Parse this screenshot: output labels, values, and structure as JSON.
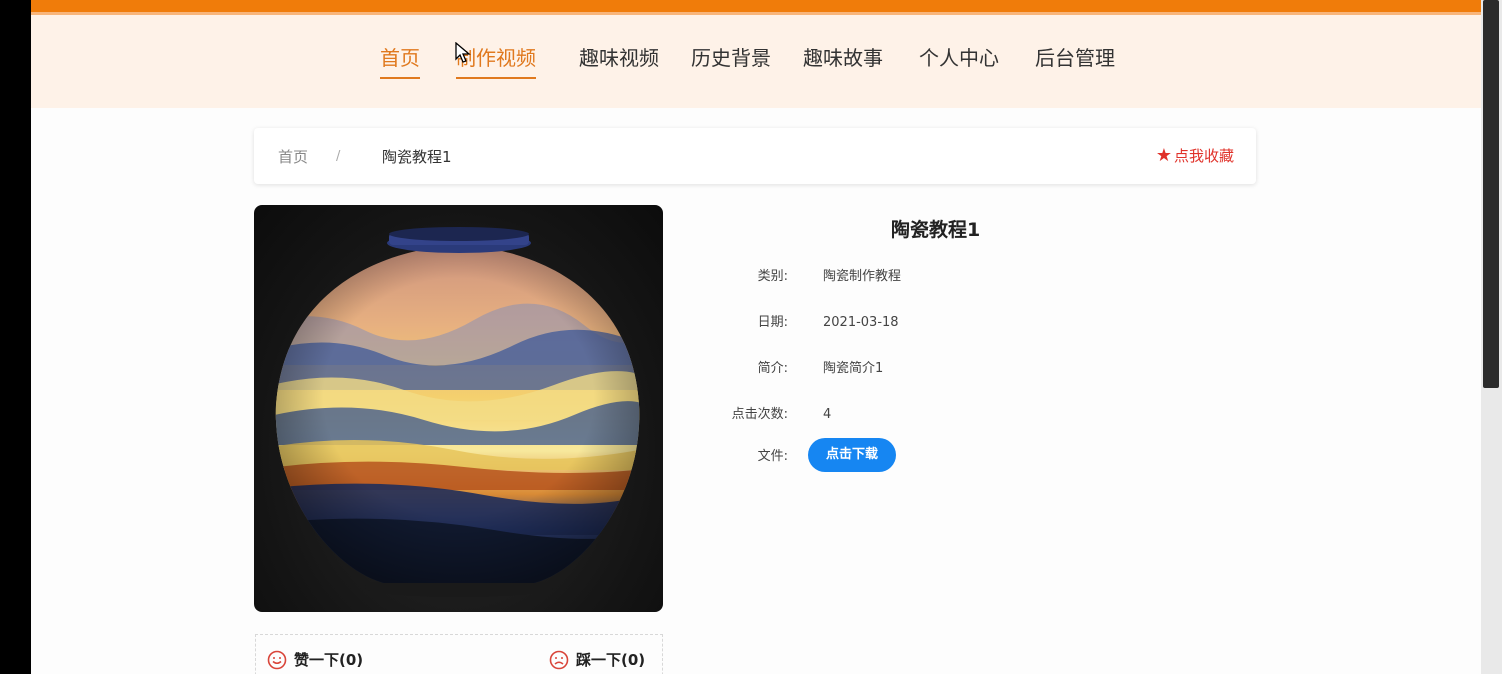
{
  "nav": {
    "items": [
      {
        "label": "首页",
        "active": true
      },
      {
        "label": "制作视频",
        "active": true
      },
      {
        "label": "趣味视频",
        "active": false
      },
      {
        "label": "历史背景",
        "active": false
      },
      {
        "label": "趣味故事",
        "active": false
      },
      {
        "label": "个人中心",
        "active": false
      },
      {
        "label": "后台管理",
        "active": false
      }
    ]
  },
  "breadcrumb": {
    "home": "首页",
    "separator": "/",
    "current": "陶瓷教程1"
  },
  "favorite": {
    "icon": "star-icon",
    "label": "点我收藏"
  },
  "detail": {
    "title": "陶瓷教程1",
    "fields": [
      {
        "label": "类别:",
        "value": "陶瓷制作教程"
      },
      {
        "label": "日期:",
        "value": "2021-03-18"
      },
      {
        "label": "简介:",
        "value": "陶瓷简介1"
      },
      {
        "label": "点击次数:",
        "value": "4"
      },
      {
        "label": "文件:",
        "value": ""
      }
    ],
    "download_label": "点击下载"
  },
  "votes": {
    "like_label": "赞一下(0)",
    "dislike_label": "踩一下(0)"
  },
  "colors": {
    "accent": "#e0791e",
    "topbar": "#f07c0a",
    "navbar_bg": "#fef2e8",
    "favorite": "#e0322a",
    "button": "#1686f2"
  }
}
